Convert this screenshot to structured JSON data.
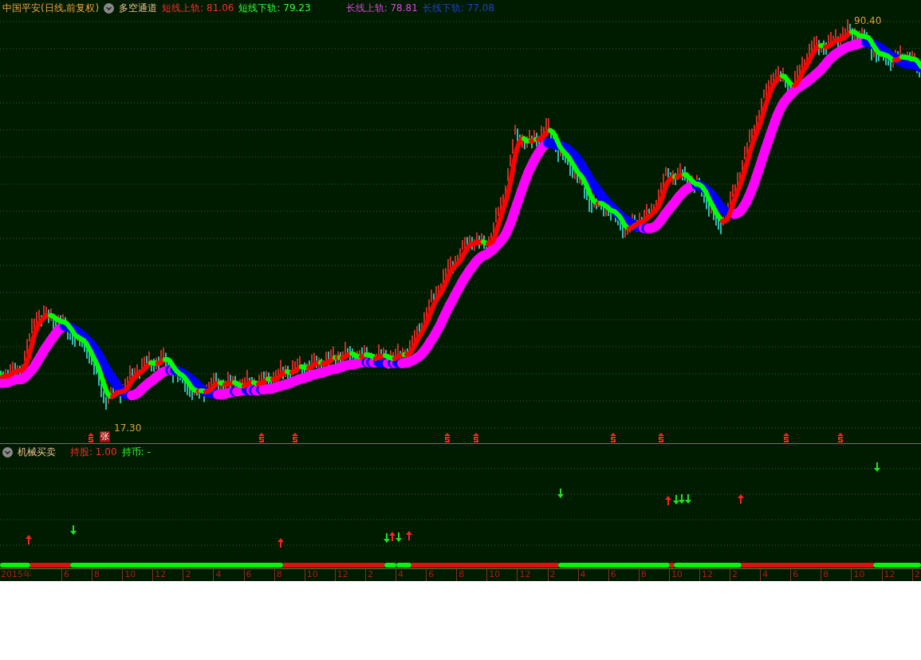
{
  "chart_header": {
    "title": "中国平安(日线,前复权)",
    "indicator": "多空通道",
    "values": [
      {
        "text": "短线上轨: 81.06",
        "color": "#ff2a2a"
      },
      {
        "text": "短线下轨: 79.23",
        "color": "#33ff33"
      },
      {
        "text": "长线上轨: 78.81",
        "color": "#e040e0"
      },
      {
        "text": "长线下轨: 77.08",
        "color": "#2040d0"
      }
    ]
  },
  "price_labels": {
    "high": "90.40",
    "low": "17.30"
  },
  "signal_badge": "张",
  "lower_panel": {
    "indicator": "机械买卖",
    "values": [
      {
        "text": "持股: 1.00",
        "color": "#ff2a2a"
      },
      {
        "text": "持币: -",
        "color": "#33ff33"
      }
    ]
  },
  "x_axis": [
    "2015年",
    "6",
    "8",
    "10",
    "12",
    "2",
    "4",
    "6",
    "8",
    "10",
    "12",
    "2",
    "4",
    "6",
    "8",
    "10",
    "12",
    "2",
    "4",
    "6",
    "8",
    "10",
    "12",
    "2",
    "4",
    "6",
    "8",
    "10",
    "12",
    "2"
  ]
}
